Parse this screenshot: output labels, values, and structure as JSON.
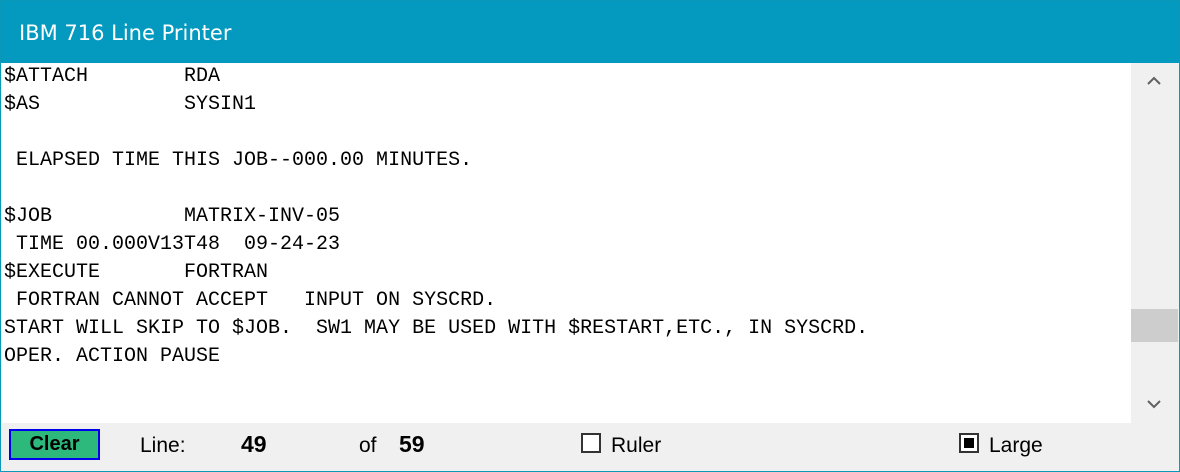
{
  "window": {
    "title": "IBM 716 Line Printer"
  },
  "printout": {
    "lines": [
      "$ATTACH        RDA",
      "$AS            SYSIN1",
      "",
      " ELAPSED TIME THIS JOB--000.00 MINUTES.",
      "",
      "$JOB           MATRIX-INV-05",
      " TIME 00.000V13T48  09-24-23",
      "$EXECUTE       FORTRAN",
      " FORTRAN CANNOT ACCEPT   INPUT ON SYSCRD.",
      "START WILL SKIP TO $JOB.  SW1 MAY BE USED WITH $RESTART,ETC., IN SYSCRD.",
      "OPER. ACTION PAUSE"
    ]
  },
  "scrollbar": {
    "up_icon": "chevron-up-icon",
    "down_icon": "chevron-down-icon"
  },
  "status": {
    "clear_label": "Clear",
    "line_label": "Line:",
    "current_line": "49",
    "of_label": "of",
    "total_lines": "59",
    "ruler_label": "Ruler",
    "ruler_checked": false,
    "large_label": "Large",
    "large_checked": true
  },
  "colors": {
    "titlebar": "#0499be",
    "clear_button": "#2db87c"
  }
}
